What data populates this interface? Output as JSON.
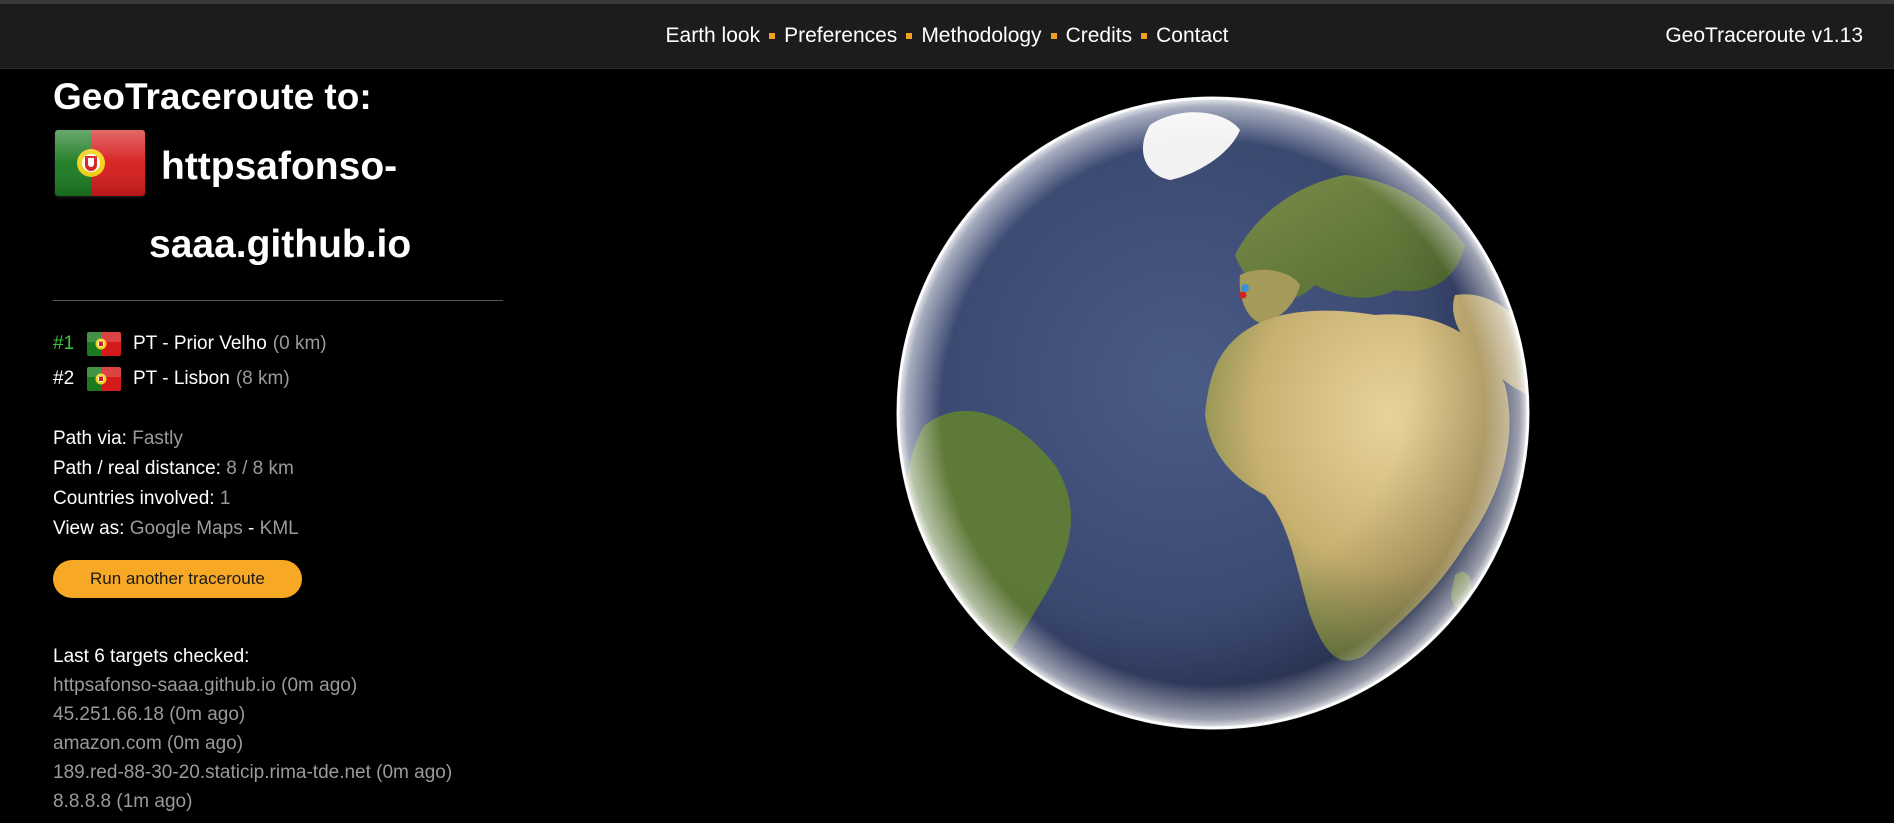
{
  "nav": {
    "links": [
      {
        "label": "Earth look"
      },
      {
        "label": "Preferences"
      },
      {
        "label": "Methodology"
      },
      {
        "label": "Credits"
      },
      {
        "label": "Contact"
      }
    ],
    "version": "GeoTraceroute v1.13"
  },
  "header": {
    "title": "GeoTraceroute to:",
    "target_line1": "httpsafonso-",
    "target_line2": "saaa.github.io",
    "flag": "portugal-flag"
  },
  "hops": [
    {
      "num": "#1",
      "country": "PT",
      "label": "PT - Prior Velho",
      "distance": "(0 km)",
      "flag": "portugal-flag"
    },
    {
      "num": "#2",
      "country": "PT",
      "label": "PT - Lisbon",
      "distance": "(8 km)",
      "flag": "portugal-flag"
    }
  ],
  "stats": {
    "path_via_label": "Path via:",
    "path_via_value": "Fastly",
    "distance_label": "Path / real distance:",
    "distance_value": "8 / 8 km",
    "countries_label": "Countries involved:",
    "countries_value": "1",
    "view_as_label": "View as:",
    "view_google": "Google Maps",
    "view_sep": "-",
    "view_kml": "KML"
  },
  "run_button": "Run another traceroute",
  "recent": {
    "title": "Last 6 targets checked:",
    "items": [
      "httpsafonso-saaa.github.io (0m ago)",
      "45.251.66.18 (0m ago)",
      "amazon.com (0m ago)",
      "189.red-88-30-20.staticip.rima-tde.net (0m ago)",
      "8.8.8.8 (1m ago)"
    ]
  },
  "colors": {
    "accent": "#f7a825",
    "hop1": "#3cc43c",
    "muted": "#9a9a9a",
    "navbar": "#1c1c1c"
  }
}
